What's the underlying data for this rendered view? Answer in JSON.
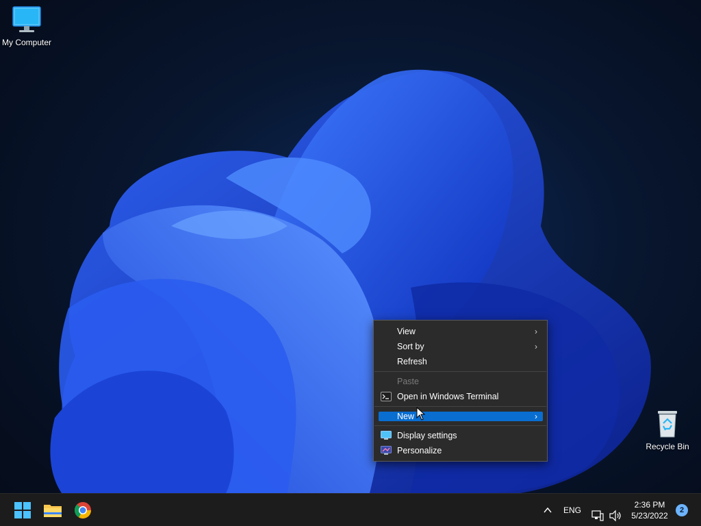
{
  "desktop": {
    "icons": [
      {
        "label": "My Computer",
        "icon": "monitor-icon"
      },
      {
        "label": "Recycle Bin",
        "icon": "recycle-bin-icon"
      }
    ]
  },
  "context_menu": {
    "items": [
      {
        "label": "View",
        "submenu": true
      },
      {
        "label": "Sort by",
        "submenu": true
      },
      {
        "label": "Refresh"
      },
      {
        "label": "Paste",
        "disabled": true
      },
      {
        "label": "Open in Windows Terminal",
        "icon": "terminal-icon"
      },
      {
        "label": "New",
        "submenu": true,
        "highlighted": true
      },
      {
        "label": "Display settings",
        "icon": "display-icon"
      },
      {
        "label": "Personalize",
        "icon": "personalize-icon"
      }
    ],
    "chevron": "›"
  },
  "taskbar": {
    "pinned": [
      {
        "name": "Start",
        "icon": "windows-start-icon"
      },
      {
        "name": "File Explorer",
        "icon": "folder-icon"
      },
      {
        "name": "Google Chrome",
        "icon": "chrome-icon"
      }
    ],
    "tray": {
      "overflow_glyph": "^",
      "language": "ENG",
      "time": "2:36 PM",
      "date": "5/23/2022",
      "notification_count": "2"
    }
  },
  "colors": {
    "accent": "#0a6ed1",
    "start_blue": "#4cc2ff",
    "menu_bg": "#2b2b2b",
    "taskbar_bg": "#1c1c1c"
  }
}
